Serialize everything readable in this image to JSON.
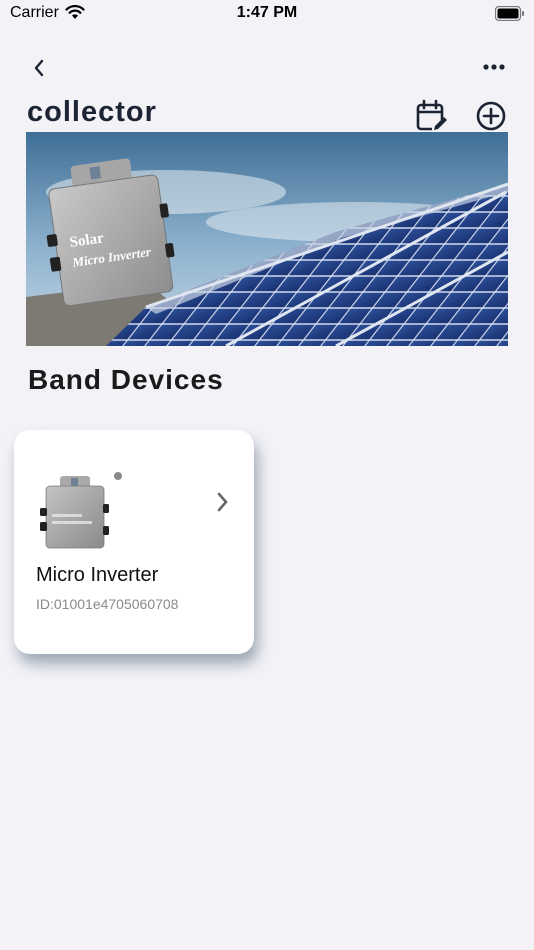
{
  "status_bar": {
    "carrier": "Carrier",
    "time": "1:47 PM"
  },
  "header": {
    "title": "collector",
    "back_icon": "chevron-left-icon",
    "more_icon": "ellipsis-icon",
    "calendar_icon": "calendar-edit-icon",
    "add_icon": "plus-circle-icon"
  },
  "banner": {
    "inverter_brand": "Solar",
    "inverter_model": "Micro Inverter"
  },
  "section": {
    "title": "Band Devices"
  },
  "devices": [
    {
      "name": "Micro Inverter",
      "id_text": "ID:01001e4705060708",
      "status_color": "#8a8a8a",
      "arrow_icon": "chevron-right-icon"
    }
  ],
  "colors": {
    "background": "#f2f2f7",
    "title": "#1c2333",
    "card": "#ffffff"
  }
}
